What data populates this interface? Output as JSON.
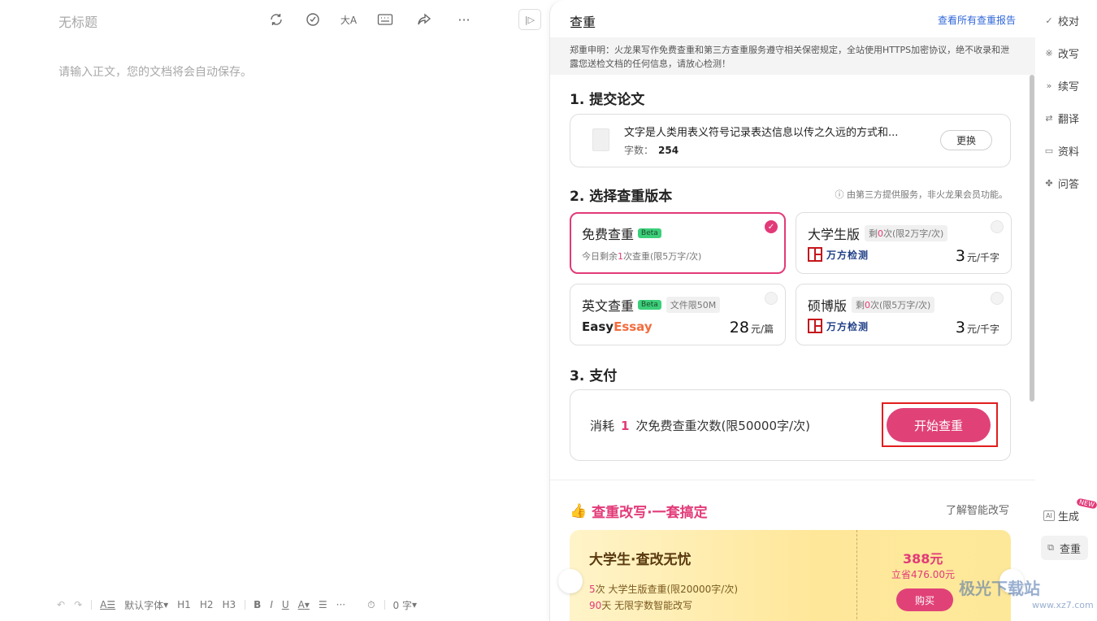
{
  "editor": {
    "title_placeholder": "无标题",
    "body_placeholder": "请输入正文，您的文档将会自动保存。",
    "toolbar_icons": [
      "sync-icon",
      "check-icon",
      "text-size-icon",
      "keyboard-icon",
      "share-icon",
      "more-icon"
    ],
    "bottom": {
      "font": "默认字体",
      "h1": "H1",
      "h2": "H2",
      "h3": "H3",
      "bold": "B",
      "italic": "I",
      "underline": "U",
      "color": "A",
      "more": "···",
      "word_count": "0 字"
    }
  },
  "panel": {
    "title": "查重",
    "view_all_link": "查看所有查重报告",
    "notice": "郑重申明：火龙果写作免费查重和第三方查重服务遵守相关保密规定，全站使用HTTPS加密协议，绝不收录和泄露您送检文档的任何信息，请放心检测！",
    "step1": {
      "heading": "1. 提交论文",
      "file_title": "文字是人类用表义符号记录表达信息以传之久远的方式和...",
      "count_label": "字数：",
      "count_value": "254",
      "replace_button": "更换"
    },
    "step2": {
      "heading": "2. 选择查重版本",
      "hint": "ⓘ 由第三方提供服务，非火龙果会员功能。",
      "options": [
        {
          "name": "免费查重",
          "badge": "Beta",
          "sub_prefix": "今日剩余",
          "sub_num": "1",
          "sub_suffix": "次查重(限5万字/次)",
          "selected": true
        },
        {
          "name": "大学生版",
          "tag_prefix": "剩",
          "tag_num": "0",
          "tag_suffix": "次(限2万字/次)",
          "brand": "万方检测",
          "price": "3",
          "unit": "元/千字"
        },
        {
          "name": "英文查重",
          "badge": "Beta",
          "tag": "文件限50M",
          "brand_a": "Easy",
          "brand_b": "Essay",
          "price": "28",
          "unit": "元/篇"
        },
        {
          "name": "硕博版",
          "tag_prefix": "剩",
          "tag_num": "0",
          "tag_suffix": "次(限5万字/次)",
          "brand": "万方检测",
          "price": "3",
          "unit": "元/千字"
        }
      ]
    },
    "step3": {
      "heading": "3. 支付",
      "consume_prefix": "消耗",
      "consume_num": "1",
      "consume_suffix": "次免费查重次数(限50000字/次)",
      "start_button": "开始查重"
    },
    "promo": {
      "heading": "查重改写·一套搞定",
      "link": "了解智能改写",
      "card_title": "大学生·查改无忧",
      "line1_num": "5",
      "line1": "次 大学生版查重(限20000字/次)",
      "line2_num": "90",
      "line2": "天 无限字数智能改写",
      "price": "388元",
      "save": "立省476.00元",
      "buy_button": "购买"
    }
  },
  "rail": {
    "items": [
      {
        "icon": "check-mark-icon",
        "label": "校对"
      },
      {
        "icon": "sparkle-icon",
        "label": "改写"
      },
      {
        "icon": "double-chevron-icon",
        "label": "续写"
      },
      {
        "icon": "swap-icon",
        "label": "翻译"
      },
      {
        "icon": "inbox-icon",
        "label": "资料"
      },
      {
        "icon": "pinwheel-icon",
        "label": "问答"
      }
    ],
    "bottom_items": [
      {
        "icon": "ai-icon",
        "label": "生成",
        "badge": "NEW"
      },
      {
        "icon": "copy-icon",
        "label": "查重"
      }
    ]
  },
  "watermark": {
    "main": "极光下载站",
    "sub": "www.xz7.com"
  },
  "colors": {
    "accent": "#e04278",
    "link": "#2f66d9",
    "highlight_box": "#e11d1d"
  }
}
